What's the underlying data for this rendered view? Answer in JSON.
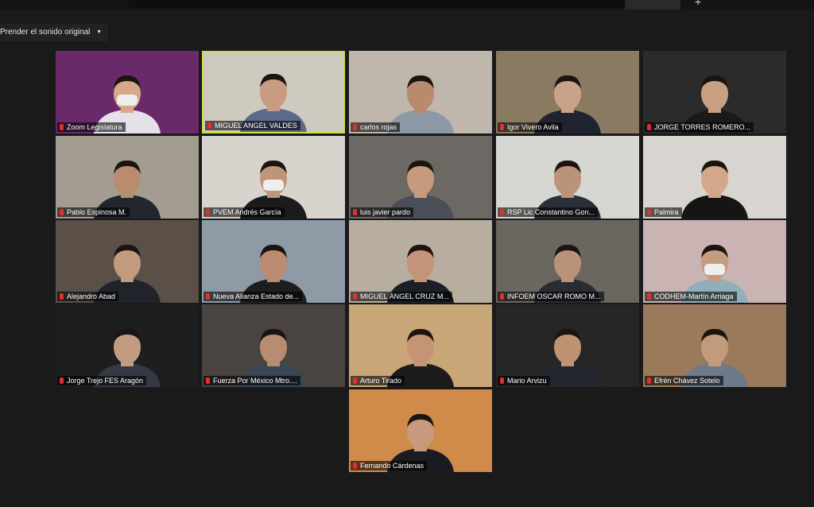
{
  "toolbar": {
    "audio_option_label": "Prender el sonido original"
  },
  "participants": [
    {
      "name": "Zoom Legislatura",
      "bg": "#6a2a6a",
      "shirt": "#e6e0e8",
      "skin": "#d7a98a",
      "mask": true,
      "active": false
    },
    {
      "name": "MIGUEL ANGEL VALDES",
      "bg": "#cfcac0",
      "shirt": "#5a6a8a",
      "skin": "#c99b80",
      "mask": false,
      "active": true
    },
    {
      "name": "carlos rojas",
      "bg": "#bfb6ac",
      "shirt": "#8c98a6",
      "skin": "#b98a6e",
      "mask": false,
      "active": false
    },
    {
      "name": "Igor Vivero Avila",
      "bg": "#8a7a62",
      "shirt": "#1f2430",
      "skin": "#caa287",
      "mask": false,
      "active": false
    },
    {
      "name": "JORGE TORRES ROMERO...",
      "bg": "#2b2b2b",
      "shirt": "#1a1a1a",
      "skin": "#c9a082",
      "mask": false,
      "active": false
    },
    {
      "name": "Pablo Espinosa M.",
      "bg": "#a39c90",
      "shirt": "#23262e",
      "skin": "#b98c70",
      "mask": false,
      "active": false
    },
    {
      "name": "PVEM Andrés García",
      "bg": "#d7d3cd",
      "shirt": "#1b1b1b",
      "skin": "#c09478",
      "mask": true,
      "active": false
    },
    {
      "name": "luis javier pardo",
      "bg": "#6c6864",
      "shirt": "#4a4e56",
      "skin": "#c69a7c",
      "mask": false,
      "active": false
    },
    {
      "name": "RSP Lic Constantino Gon...",
      "bg": "#d6d6d2",
      "shirt": "#2a2f38",
      "skin": "#bb9378",
      "mask": false,
      "active": false
    },
    {
      "name": "Palmira",
      "bg": "#d8d4d0",
      "shirt": "#151515",
      "skin": "#d4a68a",
      "mask": false,
      "active": false
    },
    {
      "name": "Alejandro Abad",
      "bg": "#5a5048",
      "shirt": "#20232a",
      "skin": "#c29a7e",
      "mask": false,
      "active": false
    },
    {
      "name": "Nueva Alianza Estado de...",
      "bg": "#8e9aa6",
      "shirt": "#1e1e1e",
      "skin": "#bc8c70",
      "mask": false,
      "active": false
    },
    {
      "name": "MIGUEL ÁNGEL CRUZ M...",
      "bg": "#b8aea0",
      "shirt": "#1c1f26",
      "skin": "#c49478",
      "mask": false,
      "active": false
    },
    {
      "name": "INFOEM OSCAR ROMO M...",
      "bg": "#6a6660",
      "shirt": "#2a2c32",
      "skin": "#ba9278",
      "mask": false,
      "active": false
    },
    {
      "name": "CODHEM-Martín Arriaga",
      "bg": "#c9b3b3",
      "shirt": "#8fb0b8",
      "skin": "#c69c80",
      "mask": true,
      "active": false
    },
    {
      "name": "Jorge Trejo FES Aragón",
      "bg": "#1e1e1e",
      "shirt": "#343a44",
      "skin": "#c29c80",
      "mask": false,
      "active": false
    },
    {
      "name": "Fuerza Por México Mtro....",
      "bg": "#4a4440",
      "shirt": "#3a4656",
      "skin": "#b88c70",
      "mask": false,
      "active": false
    },
    {
      "name": "Arturo Tirado",
      "bg": "#c8a678",
      "shirt": "#1c1c1c",
      "skin": "#c59474",
      "mask": false,
      "active": false
    },
    {
      "name": "Mario Arvizu",
      "bg": "#262626",
      "shirt": "#22262e",
      "skin": "#bf9274",
      "mask": false,
      "active": false
    },
    {
      "name": "Efrén Chávez Sotelo",
      "bg": "#9a7a5a",
      "shirt": "#6e7a8a",
      "skin": "#c29a7c",
      "mask": false,
      "active": false
    },
    {
      "name": "Fernando Cárdenas",
      "bg": "#d08a4a",
      "shirt": "#1a1c22",
      "skin": "#c79a7e",
      "mask": false,
      "active": false
    }
  ]
}
